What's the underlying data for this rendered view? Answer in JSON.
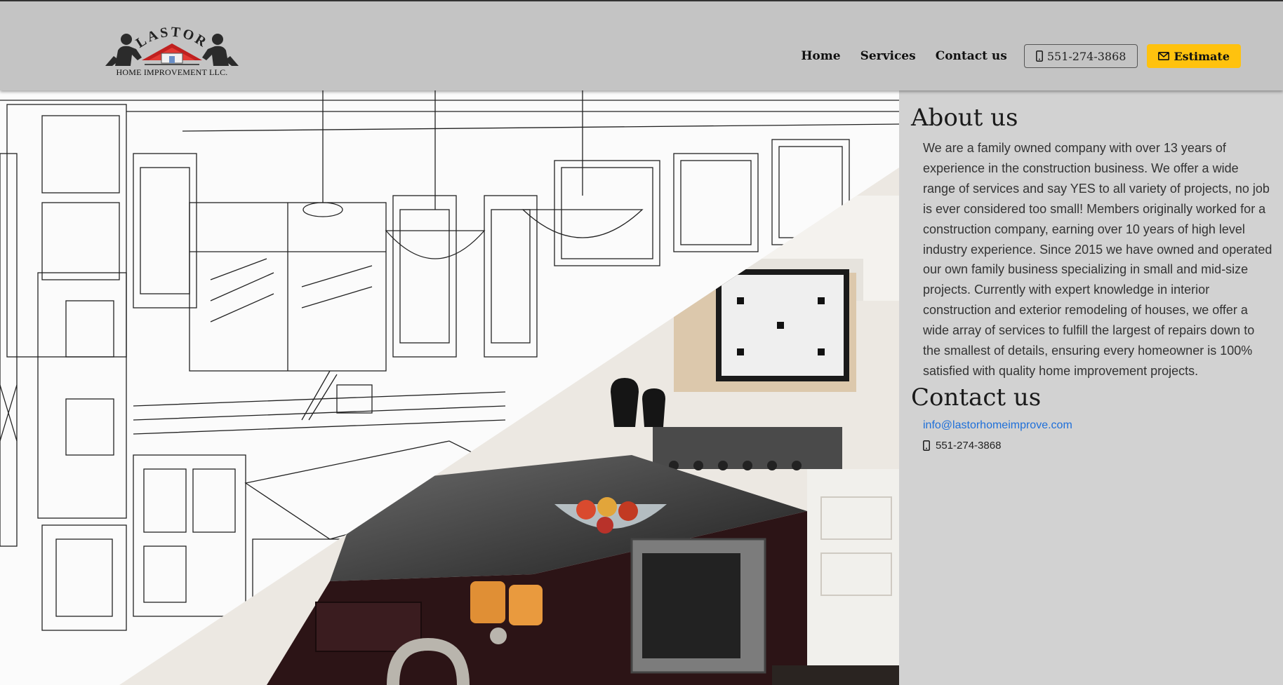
{
  "brand": {
    "logo_name": "LASTOR",
    "logo_tagline": "HOME IMPROVEMENT LLC."
  },
  "nav": {
    "home": "Home",
    "services": "Services",
    "contact": "Contact us",
    "phone": "551-274-3868",
    "phone_icon": "mobile-phone-icon",
    "estimate": "Estimate",
    "estimate_icon": "envelope-icon"
  },
  "colors": {
    "estimate_bg": "#ffc20e",
    "link": "#1e6fd9",
    "header_bg": "#c4c4c4",
    "panel_bg": "#d2d2d2"
  },
  "about": {
    "title": "About us",
    "text": "We are a family owned company with over 13 years of experience in the construction business. We offer a wide range of services and say YES to all variety of projects, no job is ever considered too small! Members originally worked for a construction company, earning over 10 years of high level industry experience. Since 2015 we have owned and operated our own family business specializing in small and mid-size projects. Currently with expert knowledge in interior construction and exterior remodeling of houses, we offer a wide array of services to fulfill the largest of repairs down to the smallest of details, ensuring every homeowner is 100% satisfied with quality home improvement projects."
  },
  "contact": {
    "title": "Contact us",
    "email": "info@lastorhomeimprove.com",
    "phone": "551-274-3868",
    "phone_icon": "mobile-phone-icon"
  }
}
